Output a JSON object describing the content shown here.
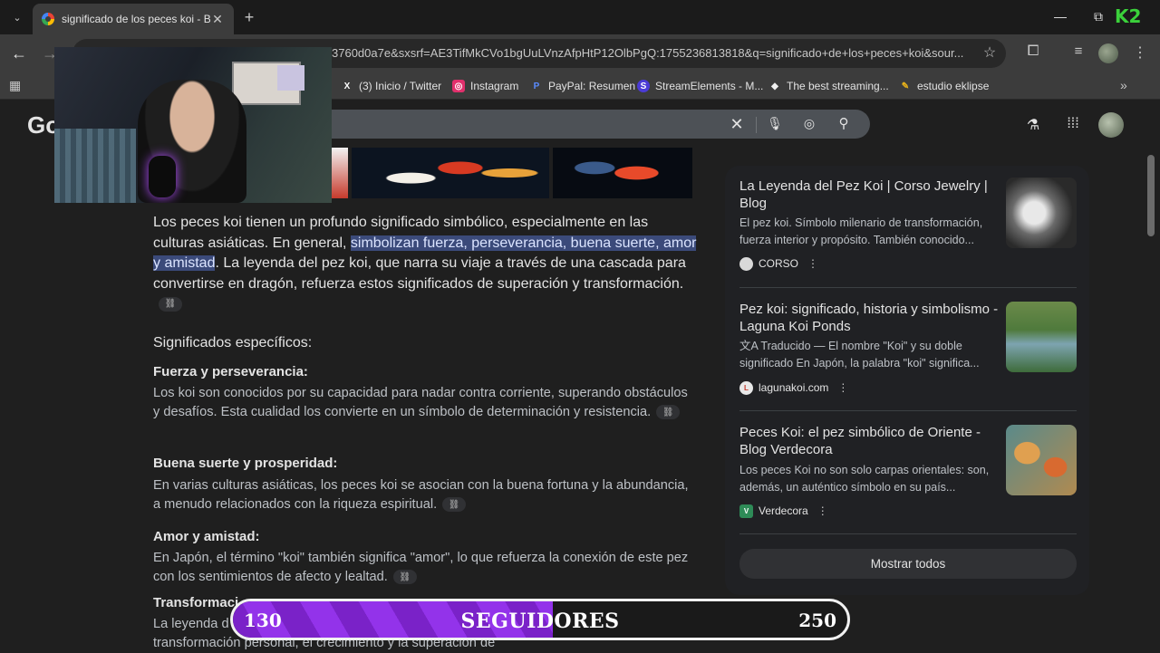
{
  "browser": {
    "tab_title": "significado de los peces koi - B...",
    "tab_close": "✕",
    "new_tab": "+",
    "url": "3760d0a7e&sxsrf=AE3TifMkCVo1bgUuLVnzAfpHtP12OlbPgQ:1755236813818&q=significado+de+los+peces+koi&sour...",
    "bookmarks": [
      {
        "label": "(3) Inicio / Twitter",
        "icon": "X",
        "color": "#000000"
      },
      {
        "label": "Instagram",
        "icon": "◎",
        "color": "#e1306c"
      },
      {
        "label": "PayPal: Resumen",
        "icon": "P",
        "color": "#1a3b8a"
      },
      {
        "label": "StreamElements - M...",
        "icon": "S",
        "color": "#4b3bd6"
      },
      {
        "label": "The best streaming...",
        "icon": "◆",
        "color": "#f1f1f1"
      },
      {
        "label": "estudio eklipse",
        "icon": "✎",
        "color": "#e8b21a"
      }
    ],
    "logo_text": "K2"
  },
  "google": {
    "logo": "Go"
  },
  "content": {
    "intro_before": "Los peces koi tienen un profundo significado simbólico, especialmente en las culturas asiáticas. En general, ",
    "intro_highlight": "simbolizan fuerza, perseverancia, buena suerte, amor y amistad",
    "intro_after": ". La leyenda del pez koi, que narra su viaje a través de una cascada para convertirse en dragón, refuerza estos significados de superación y transformación.",
    "section_heading": "Significados específicos:",
    "items": [
      {
        "title": "Fuerza y perseverancia:",
        "text": "Los koi son conocidos por su capacidad para nadar contra corriente, superando obstáculos y desafíos. Esta cualidad los convierte en un símbolo de determinación y resistencia."
      },
      {
        "title": "Buena suerte y prosperidad:",
        "text": "En varias culturas asiáticas, los peces koi se asocian con la buena fortuna y la abundancia, a menudo relacionados con la riqueza espiritual."
      },
      {
        "title": "Amor y amistad:",
        "text": "En Japón, el término \"koi\" también significa \"amor\", lo que refuerza la conexión de este pez con los sentimientos de afecto y lealtad."
      },
      {
        "title": "Transformaci",
        "text": "La leyenda d                                                  ra para convertirse en dragón, simboliza la transformación personal, el crecimiento y la superación de"
      }
    ],
    "link_icon": "🔗"
  },
  "sources": [
    {
      "title": "La Leyenda del Pez Koi | Corso Jewelry | Blog",
      "snippet": "El pez koi. Símbolo milenario de transformación, fuerza interior y propósito. También conocido...",
      "site": "CORSO",
      "fav": "",
      "fav_color": "#d9d9d9"
    },
    {
      "title": "Pez koi: significado, historia y simbolismo - Laguna Koi Ponds",
      "snippet": "文A Traducido — El nombre \"Koi\" y su doble significado En Japón, la palabra \"koi\" significa...",
      "site": "lagunakoi.com",
      "fav": "L",
      "fav_color": "#e8e8e8"
    },
    {
      "title": "Peces Koi: el pez simbólico de Oriente - Blog Verdecora",
      "snippet": "Los peces Koi no son solo carpas orientales: son, además, un auténtico símbolo en su país...",
      "site": "Verdecora",
      "fav": "V",
      "fav_color": "#2e8b57"
    }
  ],
  "show_all": "Mostrar todos",
  "followers": {
    "current": "130",
    "label": "SEGUIDORES",
    "goal": "250",
    "progress": 0.52
  }
}
